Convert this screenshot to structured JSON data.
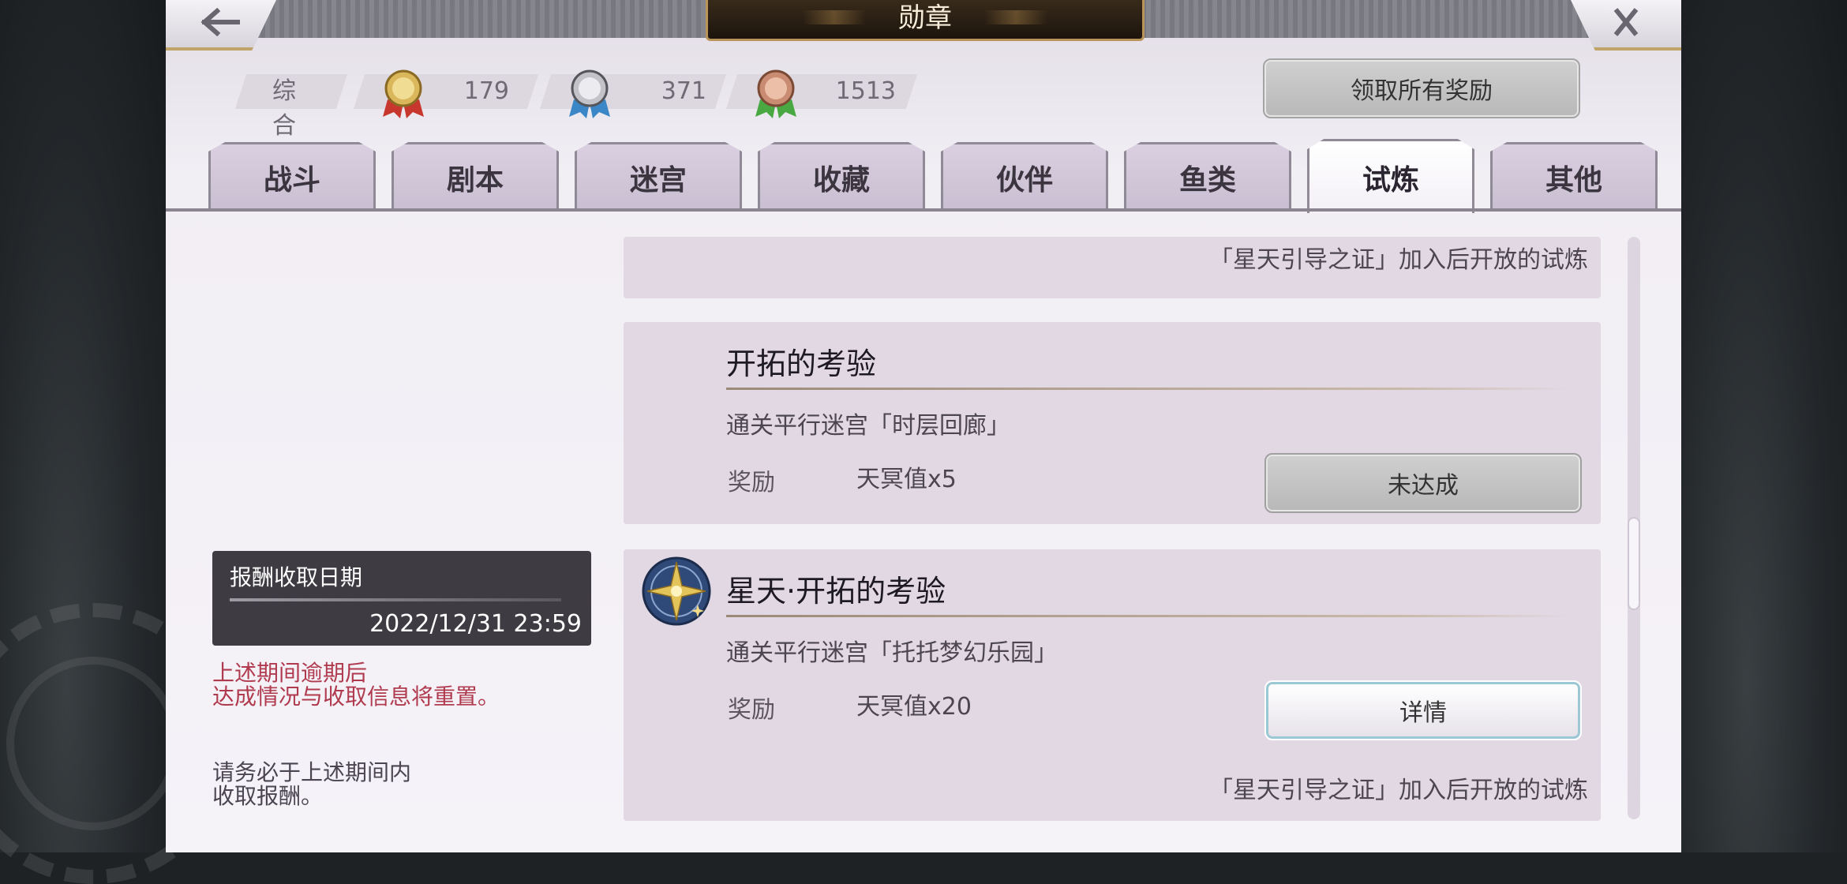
{
  "header": {
    "title": "勋章",
    "back_icon": "back-arrow-icon",
    "close_icon": "close-icon"
  },
  "medals": {
    "label": "综合",
    "gold": {
      "icon": "gold-medal-icon",
      "count": "179",
      "ribbon_color": "#c8372e"
    },
    "silver": {
      "icon": "silver-medal-icon",
      "count": "371",
      "ribbon_color": "#3b86c6"
    },
    "bronze": {
      "icon": "bronze-medal-icon",
      "count": "1513",
      "ribbon_color": "#4aa843"
    }
  },
  "claim_all_label": "领取所有奖励",
  "tabs": [
    {
      "label": "战斗",
      "active": false
    },
    {
      "label": "剧本",
      "active": false
    },
    {
      "label": "迷宫",
      "active": false
    },
    {
      "label": "收藏",
      "active": false
    },
    {
      "label": "伙伴",
      "active": false
    },
    {
      "label": "鱼类",
      "active": false
    },
    {
      "label": "试炼",
      "active": true
    },
    {
      "label": "其他",
      "active": false
    }
  ],
  "sidebar": {
    "deadline_title": "报酬收取日期",
    "deadline_date": "2022/12/31 23:59",
    "reset_warning": "上述期间逾期后\n达成情况与收取信息将重置。",
    "reminder": "请务必于上述期间内\n收取报酬。"
  },
  "cards": [
    {
      "footnote": "「星天引导之证」加入后开放的试炼"
    },
    {
      "title": "开拓的考验",
      "description": "通关平行迷宫「时层回廊」",
      "reward_label": "奖励",
      "reward_value": "天冥值x5",
      "status": "未达成"
    },
    {
      "title": "星天·开拓的考验",
      "description": "通关平行迷宫「托托梦幻乐园」",
      "reward_label": "奖励",
      "reward_value": "天冥值x20",
      "status": "详情",
      "badge_icon": "star-compass-badge-icon",
      "footnote": "「星天引导之证」加入后开放的试炼"
    }
  ]
}
